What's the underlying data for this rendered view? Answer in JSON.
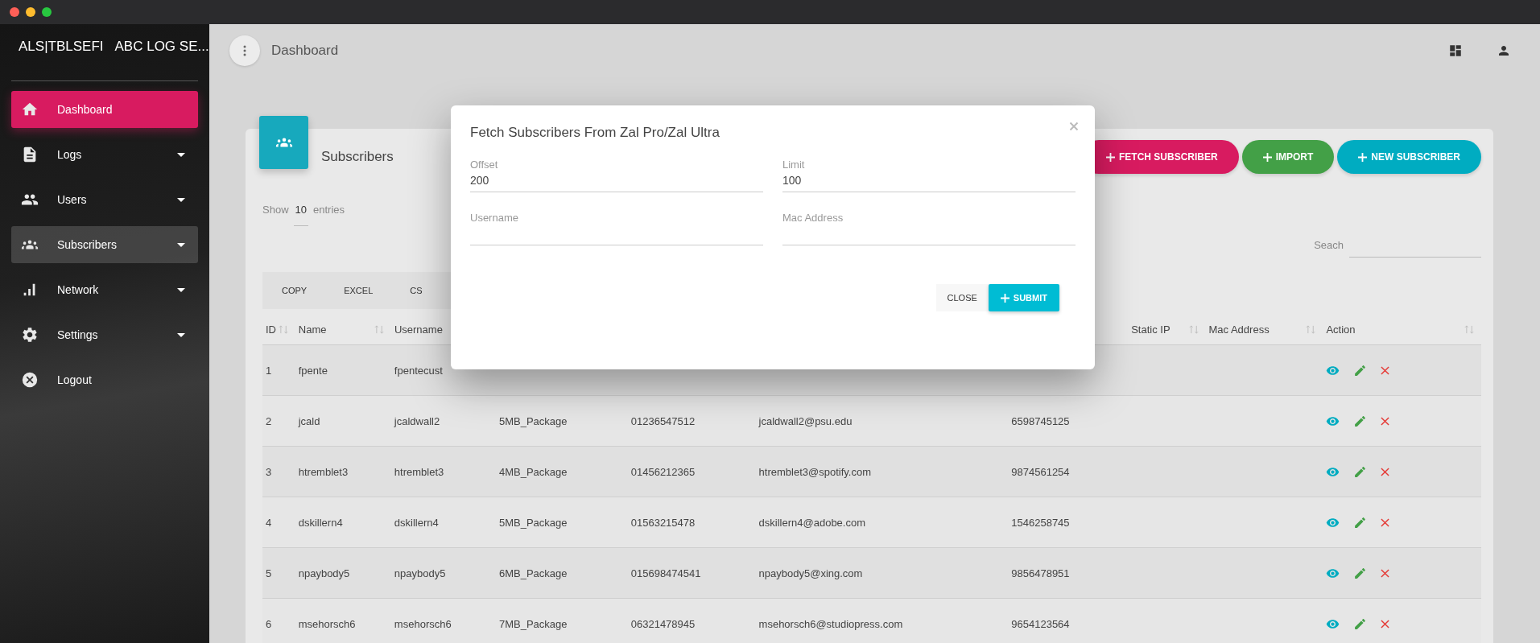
{
  "brand": {
    "short": "ALS|TBLSEFI",
    "name": "ABC LOG SE..."
  },
  "sidebar": {
    "items": [
      {
        "label": "Dashboard",
        "selected": true,
        "highlighted": false,
        "expandable": false
      },
      {
        "label": "Logs",
        "selected": false,
        "highlighted": false,
        "expandable": true
      },
      {
        "label": "Users",
        "selected": false,
        "highlighted": false,
        "expandable": true
      },
      {
        "label": "Subscribers",
        "selected": false,
        "highlighted": true,
        "expandable": true
      },
      {
        "label": "Network",
        "selected": false,
        "highlighted": false,
        "expandable": true
      },
      {
        "label": "Settings",
        "selected": false,
        "highlighted": false,
        "expandable": true
      },
      {
        "label": "Logout",
        "selected": false,
        "highlighted": false,
        "expandable": false
      }
    ]
  },
  "topbar": {
    "title": "Dashboard"
  },
  "card": {
    "title": "Subscribers",
    "buttons": [
      {
        "label": "FETCH SUBSCRIBER",
        "color": "#d81b60"
      },
      {
        "label": "IMPORT",
        "color": "#43a047"
      },
      {
        "label": "NEW SUBSCRIBER",
        "color": "#00acc1"
      }
    ],
    "show": {
      "before": "Show",
      "value": "10",
      "after": "entries"
    },
    "search": {
      "label": "Seach"
    },
    "export_buttons": [
      "COPY",
      "EXCEL",
      "CS"
    ]
  },
  "table": {
    "columns": [
      {
        "kind": "text",
        "label": "ID"
      },
      {
        "kind": "text",
        "label": "Name"
      },
      {
        "kind": "text",
        "label": "Username"
      },
      {
        "kind": "text"
      },
      {
        "kind": "text"
      },
      {
        "kind": "text"
      },
      {
        "kind": "text"
      },
      {
        "kind": "text",
        "label": "Static IP"
      },
      {
        "kind": "text",
        "label": "Mac Address"
      },
      {
        "kind": "actions",
        "label": "Action"
      }
    ],
    "rows": [
      {
        "cells": [
          "1",
          "fpente",
          "fpentecust",
          null,
          null,
          null,
          null
        ]
      },
      {
        "cells": [
          "2",
          "jcald",
          "jcaldwall2",
          "5MB_Package",
          "01236547512",
          "jcaldwall2@psu.edu",
          "6598745125"
        ]
      },
      {
        "cells": [
          "3",
          "htremblet3",
          "htremblet3",
          "4MB_Package",
          "01456212365",
          "htremblet3@spotify.com",
          "9874561254"
        ]
      },
      {
        "cells": [
          "4",
          "dskillern4",
          "dskillern4",
          "5MB_Package",
          "01563215478",
          "dskillern4@adobe.com",
          "1546258745"
        ]
      },
      {
        "cells": [
          "5",
          "npaybody5",
          "npaybody5",
          "6MB_Package",
          "015698474541",
          "npaybody5@xing.com",
          "9856478951"
        ]
      },
      {
        "cells": [
          "6",
          "msehorsch6",
          "msehorsch6",
          "7MB_Package",
          "06321478945",
          "msehorsch6@studiopress.com",
          "9654123564"
        ]
      }
    ]
  },
  "modal": {
    "title": "Fetch Subscribers From Zal Pro/Zal Ultra",
    "fields": [
      {
        "label": "Offset",
        "value": "200"
      },
      {
        "label": "Limit",
        "value": "100"
      },
      {
        "label": "Username"
      },
      {
        "label": "Mac Address"
      }
    ],
    "close_button": "CLOSE",
    "submit_button": "SUBMIT"
  }
}
